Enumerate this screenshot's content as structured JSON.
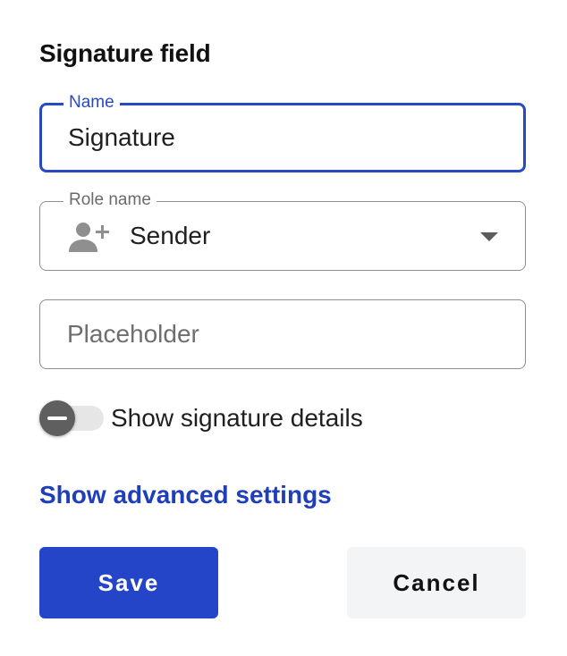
{
  "panel": {
    "title": "Signature field"
  },
  "name_field": {
    "label": "Name",
    "value": "Signature"
  },
  "role_field": {
    "label": "Role name",
    "value": "Sender",
    "icon": "person-add-icon"
  },
  "placeholder_field": {
    "placeholder": "Placeholder",
    "value": ""
  },
  "signature_details_toggle": {
    "label": "Show signature details",
    "state": "off"
  },
  "advanced_link": {
    "label": "Show advanced settings"
  },
  "actions": {
    "save_label": "Save",
    "cancel_label": "Cancel"
  },
  "colors": {
    "accent": "#2849c5",
    "primary_button": "#2445c7",
    "link": "#1f3fb8",
    "secondary_button": "#f3f4f6"
  }
}
